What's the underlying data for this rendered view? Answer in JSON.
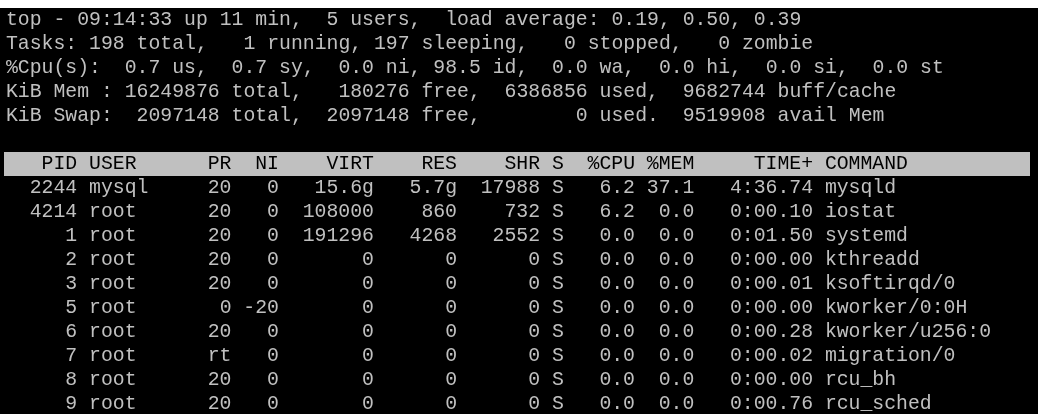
{
  "summary_lines": [
    "top - 09:14:33 up 11 min,  5 users,  load average: 0.19, 0.50, 0.39",
    "Tasks: 198 total,   1 running, 197 sleeping,   0 stopped,   0 zombie",
    "%Cpu(s):  0.7 us,  0.7 sy,  0.0 ni, 98.5 id,  0.0 wa,  0.0 hi,  0.0 si,  0.0 st",
    "KiB Mem : 16249876 total,   180276 free,  6386856 used,  9682744 buff/cache",
    "KiB Swap:  2097148 total,  2097148 free,        0 used.  9519908 avail Mem"
  ],
  "table": {
    "columns": [
      "PID",
      "USER",
      "PR",
      "NI",
      "VIRT",
      "RES",
      "SHR",
      "S",
      "%CPU",
      "%MEM",
      "TIME+",
      "COMMAND"
    ],
    "rows": [
      [
        "2244",
        "mysql",
        "20",
        "0",
        "15.6g",
        "5.7g",
        "17988",
        "S",
        "6.2",
        "37.1",
        "4:36.74",
        "mysqld"
      ],
      [
        "4214",
        "root",
        "20",
        "0",
        "108000",
        "860",
        "732",
        "S",
        "6.2",
        "0.0",
        "0:00.10",
        "iostat"
      ],
      [
        "1",
        "root",
        "20",
        "0",
        "191296",
        "4268",
        "2552",
        "S",
        "0.0",
        "0.0",
        "0:01.50",
        "systemd"
      ],
      [
        "2",
        "root",
        "20",
        "0",
        "0",
        "0",
        "0",
        "S",
        "0.0",
        "0.0",
        "0:00.00",
        "kthreadd"
      ],
      [
        "3",
        "root",
        "20",
        "0",
        "0",
        "0",
        "0",
        "S",
        "0.0",
        "0.0",
        "0:00.01",
        "ksoftirqd/0"
      ],
      [
        "5",
        "root",
        "0",
        "-20",
        "0",
        "0",
        "0",
        "S",
        "0.0",
        "0.0",
        "0:00.00",
        "kworker/0:0H"
      ],
      [
        "6",
        "root",
        "20",
        "0",
        "0",
        "0",
        "0",
        "S",
        "0.0",
        "0.0",
        "0:00.28",
        "kworker/u256:0"
      ],
      [
        "7",
        "root",
        "rt",
        "0",
        "0",
        "0",
        "0",
        "S",
        "0.0",
        "0.0",
        "0:00.02",
        "migration/0"
      ],
      [
        "8",
        "root",
        "20",
        "0",
        "0",
        "0",
        "0",
        "S",
        "0.0",
        "0.0",
        "0:00.00",
        "rcu_bh"
      ],
      [
        "9",
        "root",
        "20",
        "0",
        "0",
        "0",
        "0",
        "S",
        "0.0",
        "0.0",
        "0:00.76",
        "rcu_sched"
      ]
    ]
  }
}
